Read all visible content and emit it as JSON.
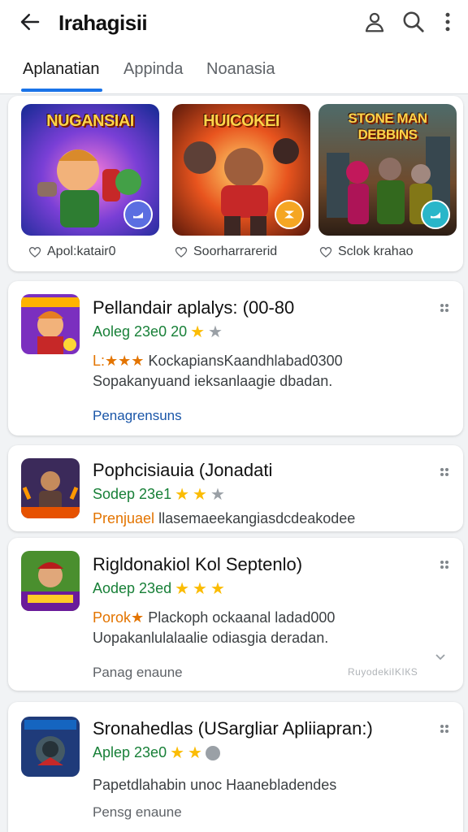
{
  "appbar": {
    "title": "Irahagisii",
    "back_icon": "arrow-left-icon",
    "actions": [
      "account-icon",
      "search-icon",
      "more-vert-icon"
    ]
  },
  "tabs": [
    {
      "label": "Aplanatian",
      "selected": true
    },
    {
      "label": "Appinda",
      "selected": false
    },
    {
      "label": "Noanasia",
      "selected": false
    }
  ],
  "featured": [
    {
      "banner": "NUGANSIAI",
      "label": "Apol:katair0",
      "badge_color": "#5b6ee1"
    },
    {
      "banner": "HUICOKEI",
      "label": "Soorharrarerid",
      "badge_color": "#f5a623"
    },
    {
      "banner": "STONE MAN DEBBINS",
      "label": "Sclok krahao",
      "badge_color": "#29b6c9"
    }
  ],
  "cards": [
    {
      "title": "Pellandair aplalys: (00-80",
      "meta": "Aoleg 23e0 20",
      "stars": [
        "star",
        "star-grey"
      ],
      "desc_prefix": "L:★★★",
      "desc1": "KockapiansKaandhlabad0300",
      "desc2": "Sopakanyuand ieksanlaagie dbadan.",
      "link": "Penagrensuns",
      "link_color": "#1a56a8"
    },
    {
      "title": "Pophcisiauia (Jonadati",
      "meta": "Sodep 23e1",
      "stars": [
        "star",
        "star",
        "star-grey"
      ],
      "desc_prefix": "Prenjuael",
      "desc1": "llasemaeekangiasdcdeakodee",
      "desc2": "",
      "link": "",
      "link_color": "#5f6368"
    },
    {
      "title": "Rigldonakiol Kol Septenlo)",
      "meta": "Aodep 23ed",
      "stars": [
        "star",
        "star",
        "star"
      ],
      "desc_prefix": "Porok★",
      "desc1": "Plackoph ockaanal ladad000",
      "desc2": "Uopakanlulalaalie odiasgia deradan.",
      "link": "Panag enaune",
      "stamp": "RuyodekіІKIКS",
      "link_color": "#5f6368"
    },
    {
      "title": "Sronahedlas (USargliar Apliiapran:)",
      "meta": "Aplep 23e0",
      "stars": [
        "star",
        "star",
        "dot"
      ],
      "desc_prefix": "",
      "desc1": "Papetdlahabin unoc Haanebladendes",
      "desc2": "",
      "link": "Pensg enaune",
      "link_color": "#5f6368"
    }
  ],
  "colors": {
    "accent": "#1a73e8",
    "star": "#fbbc04",
    "meta_green": "#188038"
  }
}
